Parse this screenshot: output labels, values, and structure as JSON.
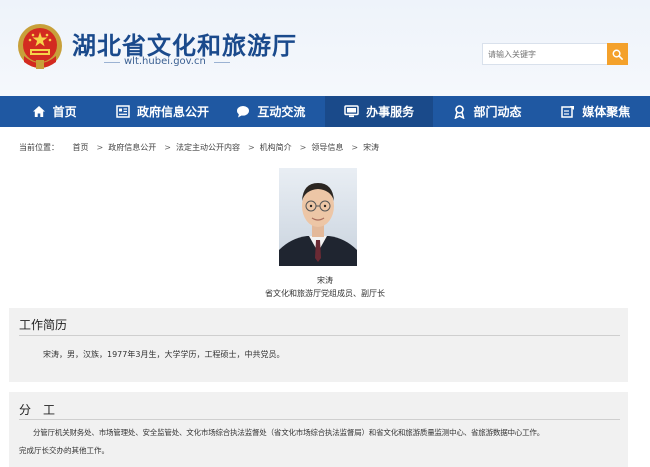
{
  "header": {
    "site_title": "湖北省文化和旅游厅",
    "site_url": "wlt.hubei.gov.cn",
    "search_placeholder": "请输入关键字"
  },
  "nav": {
    "items": [
      {
        "label": "首页",
        "icon": "home-icon"
      },
      {
        "label": "政府信息公开",
        "icon": "document-icon"
      },
      {
        "label": "互动交流",
        "icon": "chat-icon"
      },
      {
        "label": "办事服务",
        "icon": "monitor-icon"
      },
      {
        "label": "部门动态",
        "icon": "award-icon"
      },
      {
        "label": "媒体聚焦",
        "icon": "edit-icon"
      }
    ],
    "active_index": 3
  },
  "breadcrumb": {
    "prefix": "当前位置：",
    "items": [
      "首页",
      "政府信息公开",
      "法定主动公开内容",
      "机构简介",
      "领导信息",
      "宋涛"
    ],
    "separator": ">"
  },
  "profile": {
    "name": "宋涛",
    "title": "省文化和旅游厅党组成员、副厅长"
  },
  "resume": {
    "heading": "工作简历",
    "text": "宋涛，男，汉族，1977年3月生，大学学历，工程硕士，中共党员。"
  },
  "duties": {
    "heading": "分　工",
    "text_line1": "分管厅机关财务处、市场管理处、安全监管处、文化市场综合执法监督处（省文化市场综合执法监督局）和省文化和旅游质量监测中心、省旅游数据中心工作。",
    "text_line2": "完成厅长交办的其他工作。"
  },
  "colors": {
    "nav_bg": "#1f58a2",
    "title_blue": "#1a4a8c",
    "search_orange": "#f4a12b"
  }
}
